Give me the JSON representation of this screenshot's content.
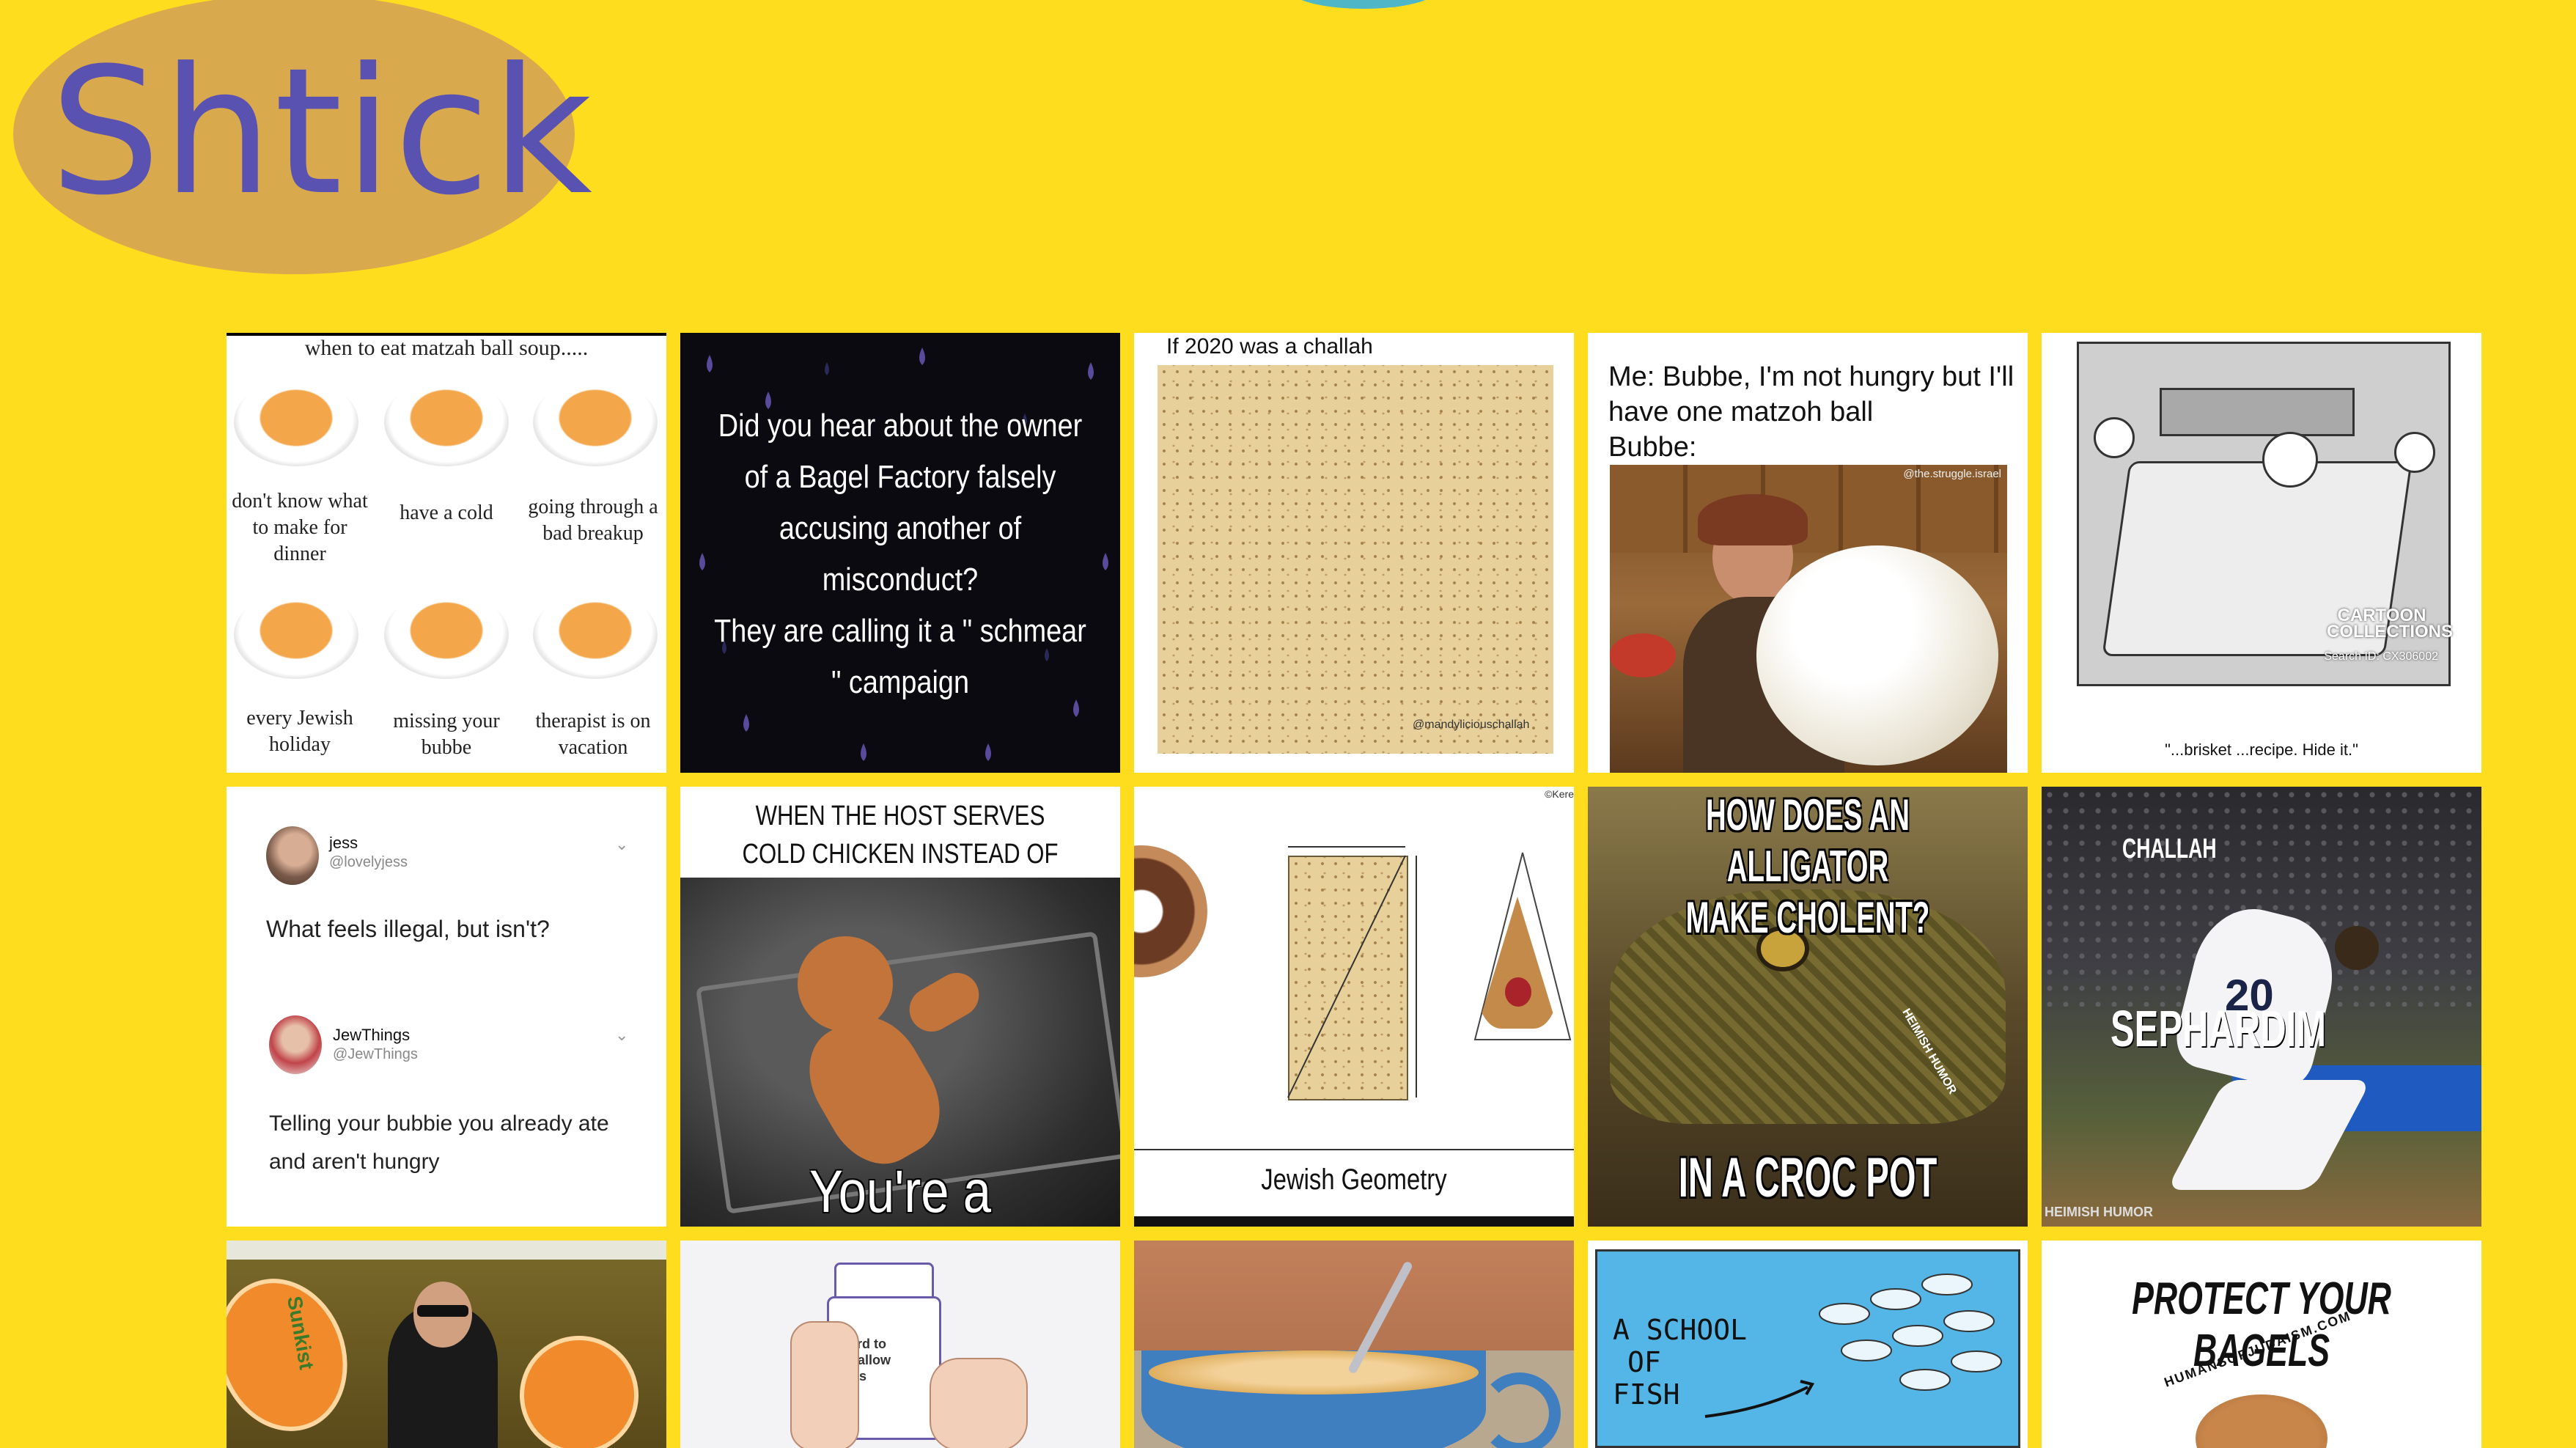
{
  "brand": {
    "logo_text": "Shtick"
  },
  "tiles": {
    "soup": {
      "title": "when to eat matzah ball soup.....",
      "labels": [
        "don't know what to make for dinner",
        "have a cold",
        "going through a bad breakup",
        "every Jewish holiday",
        "missing your bubbe",
        "therapist is on vacation"
      ]
    },
    "bagel_joke": {
      "lines": [
        "Did you hear about the owner",
        "of a Bagel Factory falsely",
        "accusing another of",
        "misconduct?",
        "They are calling it a \" schmear",
        "\" campaign"
      ]
    },
    "challah2020": {
      "title": "If 2020 was a challah",
      "credit": "@mandyliciouschallah"
    },
    "matzoh_ball": {
      "text": "Me: Bubbe, I'm not hungry but I'll have one matzoh ball",
      "text2": "Bubbe:",
      "credit": "@the.struggle.israel"
    },
    "cartoon": {
      "caption": "\"...brisket ...recipe.   Hide it.\"",
      "brand1": "CARTOON",
      "brand2": "COLLECTIONS",
      "search_id": "Search ID: CX306002"
    },
    "tweet": {
      "user1_name": "jess",
      "user1_handle": "@lovelyjess",
      "user1_text": "What feels illegal, but isn't?",
      "user2_name": "JewThings",
      "user2_handle": "@JewThings",
      "user2_text_1": "Telling your bubbie you already ate",
      "user2_text_2": "and aren't hungry"
    },
    "host": {
      "top1": "WHEN THE HOST SERVES",
      "top2": "COLD CHICKEN INSTEAD OF CHOLENT",
      "bottom": "You're a monster!"
    },
    "geometry": {
      "caption": "Jewish Geometry",
      "mark": "©Kere"
    },
    "alligator": {
      "top1": "HOW DOES AN ALLIGATOR",
      "top2": "MAKE CHOLENT?",
      "bottom": "IN A CROC POT",
      "side": "HEIMISH HUMOR"
    },
    "baseball": {
      "label1": "CHALLAH",
      "label2": "SEPHARDIM",
      "credit": "HEIMISH HUMOR",
      "jersey": "20"
    },
    "matrix": {
      "brand": "Sunkist"
    },
    "pills": {
      "label": "Hard to swallow pills"
    },
    "school": {
      "text1": "A SCHOOL",
      "text2": "OF",
      "text3": "FISH"
    },
    "protect": {
      "title": "PROTECT YOUR BAGELS",
      "site": "HUMANSOFJUDAISM.COM"
    }
  }
}
